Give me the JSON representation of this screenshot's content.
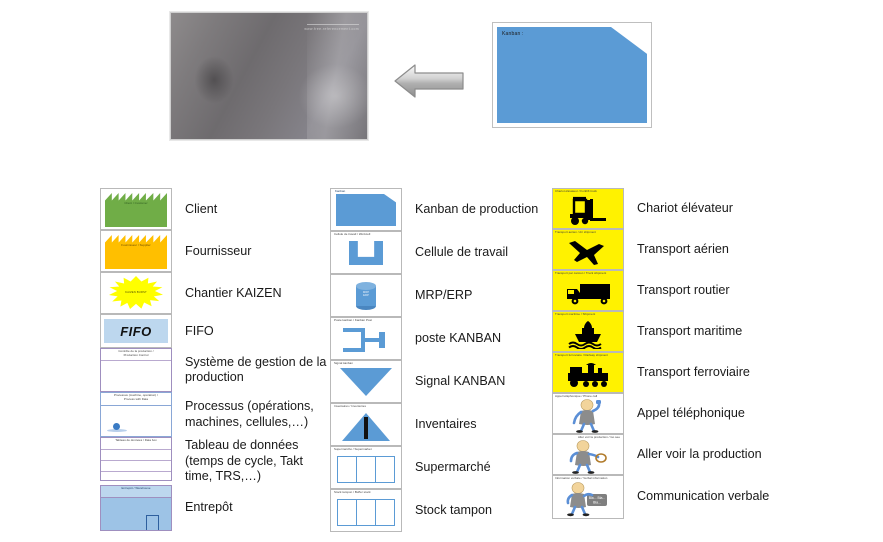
{
  "top": {
    "photo": {
      "name": "kanban-card-photo",
      "watermark": "www.free-referencement.com"
    },
    "arrow": {
      "direction": "left"
    },
    "kanban_card": {
      "label": "Kanban :"
    }
  },
  "legend": {
    "columns": [
      {
        "id": "col-left",
        "rows": [
          {
            "label": "Client",
            "tile_caption": "Client / Customer",
            "icon": "factory-green-icon"
          },
          {
            "label": "Fournisseur",
            "tile_caption": "Fournisseur / Supplier",
            "icon": "factory-orange-icon"
          },
          {
            "label": "Chantier KAIZEN",
            "tile_caption": "KAIZEN BURST",
            "icon": "kaizen-burst-icon"
          },
          {
            "label": "FIFO",
            "tile_caption": "FIFO",
            "icon": "fifo-icon"
          },
          {
            "label": "Système de gestion de la production",
            "tile_caption": "Contrôle de la production /\nProduction Control",
            "icon": "production-control-icon"
          },
          {
            "label": "Processus (opérations, machines, cellules,…)",
            "tile_caption": "Processus (machine, opération) /\nProcess with Data",
            "icon": "process-box-icon"
          },
          {
            "label": "Tableau de données (temps de cycle, Takt time, TRS,…)",
            "tile_caption": "Tableau de données / Data box",
            "icon": "data-box-icon"
          },
          {
            "label": "Entrepôt",
            "tile_caption": "Entrepôt / Warehouse",
            "icon": "warehouse-icon"
          }
        ]
      },
      {
        "id": "col-mid",
        "rows": [
          {
            "label": "Kanban de production",
            "tile_caption": "Kanban",
            "icon": "kanban-production-icon"
          },
          {
            "label": "Cellule de travail",
            "tile_caption": "Cellule de travail / Workcell",
            "icon": "workcell-icon"
          },
          {
            "label": "MRP/ERP",
            "tile_caption": "",
            "icon": "mrp-erp-database-icon"
          },
          {
            "label": "poste KANBAN",
            "tile_caption": "Poste kanban / Kanban Post",
            "icon": "kanban-post-icon"
          },
          {
            "label": "Signal KANBAN",
            "tile_caption": "Signal kanban",
            "icon": "signal-kanban-icon"
          },
          {
            "label": "Inventaires",
            "tile_caption": "Inventaires / Inventories",
            "icon": "inventory-triangle-icon"
          },
          {
            "label": "Supermarché",
            "tile_caption": "Supermarché / Supermarket",
            "icon": "supermarket-icon"
          },
          {
            "label": "Stock tampon",
            "tile_caption": "Stock tampon / Buffer stock",
            "icon": "buffer-stock-icon"
          }
        ]
      },
      {
        "id": "col-right",
        "rows": [
          {
            "label": "Chariot élévateur",
            "tile_caption": "Chariot élévateur / Forklift truck",
            "icon": "forklift-icon"
          },
          {
            "label": "Transport aérien",
            "tile_caption": "Transport aérien / Air shipment",
            "icon": "airplane-icon"
          },
          {
            "label": "Transport routier",
            "tile_caption": "Transport par camion / Truck shipment",
            "icon": "truck-icon"
          },
          {
            "label": "Transport maritime",
            "tile_caption": "Transport maritime / Shipment",
            "icon": "ship-icon"
          },
          {
            "label": "Transport ferroviaire",
            "tile_caption": "Transport ferroviaire / Railway shipment",
            "icon": "train-icon"
          },
          {
            "label": "Appel téléphonique",
            "tile_caption": "Appel téléphonique / Phone call",
            "icon": "person-phone-icon"
          },
          {
            "label": "Aller voir la production",
            "tile_caption": "Aller voir la production / Go see",
            "icon": "person-looking-icon"
          },
          {
            "label": "Communication verbale",
            "tile_caption": "Information verbale / Verbal information",
            "icon": "person-speaking-icon"
          }
        ]
      }
    ]
  },
  "colors": {
    "blue": "#5B9BD5",
    "green": "#70AD47",
    "orange": "#FFBF00",
    "yellow": "#FFF200",
    "kaizen_yellow": "#FFFF00",
    "fifo_blue": "#BDD7EE",
    "warehouse_blue": "#9DC3E6",
    "arrow_grey": "#A6A6A6",
    "text": "#1A1A1A"
  }
}
